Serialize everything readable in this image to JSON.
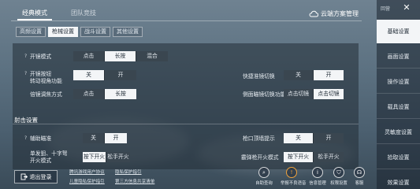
{
  "top_tabs": [
    {
      "label": "经典模式",
      "active": true
    },
    {
      "label": "团队竞技",
      "active": false
    }
  ],
  "cloud_link": "云端方案管理",
  "sub_tabs": [
    {
      "label": "高频设置",
      "active": false
    },
    {
      "label": "枪械设置",
      "active": true
    },
    {
      "label": "战斗设置",
      "active": false
    },
    {
      "label": "其他设置",
      "active": false
    }
  ],
  "settings": {
    "scope_mode": {
      "help": "?",
      "label": "开镜模式",
      "options": [
        "点击",
        "长按",
        "混合"
      ],
      "selected": 1
    },
    "scope_button_turn": {
      "help": "?",
      "label_line1": "开镜按钮",
      "label_line2": "转动视角功能",
      "options": [
        "关",
        "开"
      ],
      "selected": 1
    },
    "zoom_mode": {
      "label": "倍镜调焦方式",
      "options": [
        "点击",
        "长按"
      ],
      "selected": 1
    },
    "quick_scope_switch": {
      "label": "快捷准镜切换",
      "options": [
        "关",
        "开"
      ],
      "selected": 1
    },
    "side_scope_switch": {
      "label": "侧面瞄镜切换功能",
      "options": [
        "点击切镜",
        "点击切镜"
      ],
      "selected": 1
    }
  },
  "shooting_section": "射击设置",
  "shooting": {
    "aim_assist": {
      "help": "?",
      "label": "辅助瞄准",
      "options": [
        "关",
        "开"
      ],
      "selected": 1
    },
    "muzzle_hint": {
      "label": "枪口顶墙提示",
      "options": [
        "关",
        "开"
      ],
      "selected": 0
    },
    "single_fire": {
      "label_line1": "单发狙、十字弩",
      "label_line2": "开火模式",
      "options": [
        "按下开火",
        "松手开火"
      ],
      "selected": 0
    },
    "shotgun_fire": {
      "label": "霰弹枪开火模式",
      "options": [
        "按下开火",
        "松手开火"
      ],
      "selected": 0
    }
  },
  "bottom": {
    "logout": "退出登录",
    "links": [
      "腾讯游戏用户协议",
      "隐私保护指引",
      "儿童隐私保护指引",
      "第三方信息共享清单"
    ],
    "icons": [
      {
        "label": "自助查询",
        "icon": "search-icon"
      },
      {
        "label": "举报不良语音",
        "icon": "report-icon"
      },
      {
        "label": "信息管理",
        "icon": "info-icon"
      },
      {
        "label": "权限设置",
        "icon": "shield-icon"
      },
      {
        "label": "客服",
        "icon": "headset-icon"
      }
    ]
  },
  "sidebar": {
    "home": "回营",
    "items": [
      {
        "label": "基础设置",
        "active": true
      },
      {
        "label": "画面设置",
        "active": false
      },
      {
        "label": "操作设置",
        "active": false
      },
      {
        "label": "载具设置",
        "active": false
      },
      {
        "label": "灵敏度设置",
        "active": false
      },
      {
        "label": "拾取设置",
        "active": false
      },
      {
        "label": "效果设置",
        "active": false
      }
    ]
  },
  "colors": {
    "selected": "#f3f5f7",
    "unselected": "#3a4650",
    "accent_orange": "#f0a33c"
  }
}
